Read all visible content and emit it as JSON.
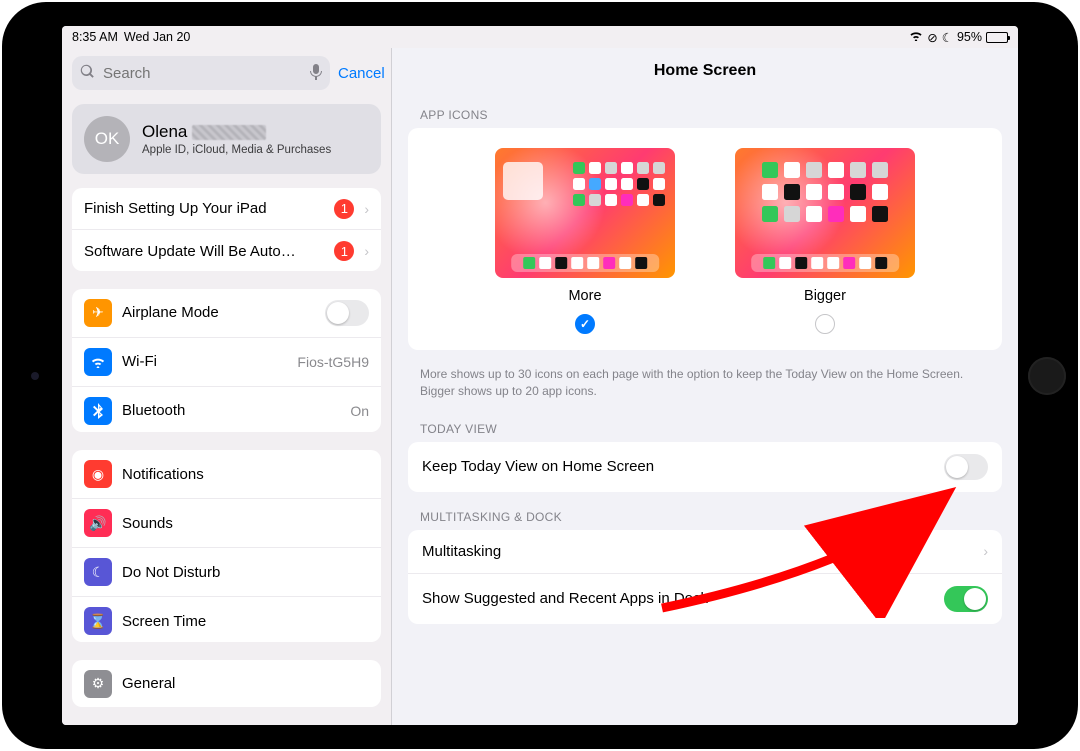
{
  "status": {
    "time": "8:35 AM",
    "date": "Wed Jan 20",
    "battery_pct": "95%"
  },
  "sidebar": {
    "search_placeholder": "Search",
    "cancel": "Cancel",
    "profile": {
      "initials": "OK",
      "name": "Olena",
      "subtitle": "Apple ID, iCloud, Media & Purchases"
    },
    "alerts": [
      {
        "label": "Finish Setting Up Your iPad",
        "badge": "1"
      },
      {
        "label": "Software Update Will Be Auto…",
        "badge": "1"
      }
    ],
    "network": {
      "airplane": "Airplane Mode",
      "wifi": "Wi-Fi",
      "wifi_value": "Fios-tG5H9",
      "bluetooth": "Bluetooth",
      "bluetooth_value": "On"
    },
    "notifications_group": {
      "notifications": "Notifications",
      "sounds": "Sounds",
      "dnd": "Do Not Disturb",
      "screentime": "Screen Time"
    },
    "general": "General"
  },
  "detail": {
    "title": "Home Screen",
    "sections": {
      "app_icons": {
        "header": "APP ICONS",
        "options": [
          {
            "label": "More",
            "selected": true
          },
          {
            "label": "Bigger",
            "selected": false
          }
        ],
        "footnote": "More shows up to 30 icons on each page with the option to keep the Today View on the Home Screen. Bigger shows up to 20 app icons."
      },
      "today_view": {
        "header": "TODAY VIEW",
        "row_label": "Keep Today View on Home Screen",
        "toggle_on": false
      },
      "multitasking": {
        "header": "MULTITASKING & DOCK",
        "multitasking_label": "Multitasking",
        "suggested_label": "Show Suggested and Recent Apps in Dock",
        "suggested_on": true
      }
    }
  }
}
